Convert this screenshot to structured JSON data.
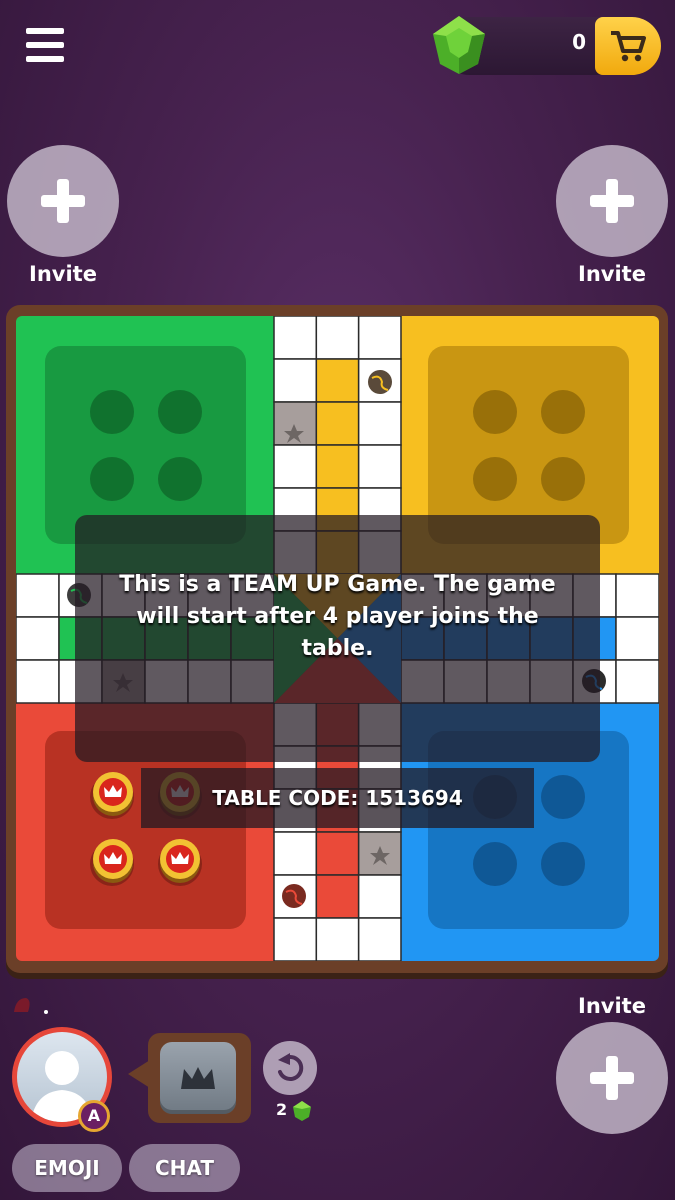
{
  "header": {
    "menu_icon": "hamburger-menu-icon",
    "gem_icon": "green-gem-icon",
    "gem_balance": "0",
    "cart_icon": "shopping-cart-icon"
  },
  "invites": {
    "top_left_label": "Invite",
    "top_right_label": "Invite",
    "bottom_right_label": "Invite",
    "icon": "plus-icon"
  },
  "board": {
    "colors": {
      "green": "#20c253",
      "yellow": "#f7bf20",
      "red": "#ea4a39",
      "blue": "#2196f3",
      "safe_star": "#a79e9c"
    },
    "home_token_color": "red",
    "home_tokens_count": 4
  },
  "overlay": {
    "message": "This is a TEAM UP Game. The game will start after 4 player joins the table.",
    "table_code": "TABLE CODE: 1513694"
  },
  "player": {
    "badge": "A",
    "avatar_icon": "default-user-avatar-icon",
    "dice_icon": "crown-dice-icon",
    "undo_icon": "undo-arrow-icon",
    "undo_cost": "2"
  },
  "actions": {
    "emoji_label": "EMOJI",
    "chat_label": "CHAT"
  }
}
